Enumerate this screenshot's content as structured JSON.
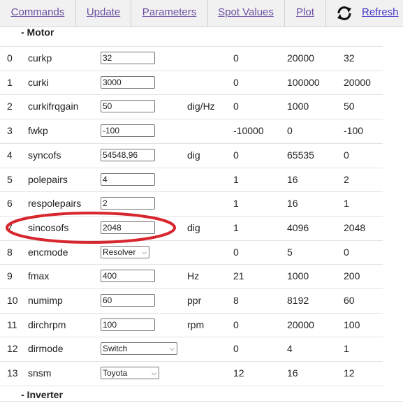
{
  "nav": {
    "commands": "Commands",
    "update": "Update",
    "parameters": "Parameters",
    "spot_values": "Spot Values",
    "plot": "Plot",
    "refresh": "Refresh",
    "refresh_icon": "refresh-icon"
  },
  "sections": {
    "motor": "- Motor",
    "inverter": "- Inverter"
  },
  "rows": [
    {
      "idx": "0",
      "name": "curkp",
      "value": "32",
      "unit": "",
      "min": "0",
      "max": "20000",
      "default": "32"
    },
    {
      "idx": "1",
      "name": "curki",
      "value": "3000",
      "unit": "",
      "min": "0",
      "max": "100000",
      "default": "20000"
    },
    {
      "idx": "2",
      "name": "curkifrqgain",
      "value": "50",
      "unit": "dig/Hz",
      "min": "0",
      "max": "1000",
      "default": "50"
    },
    {
      "idx": "3",
      "name": "fwkp",
      "value": "-100",
      "unit": "",
      "min": "-10000",
      "max": "0",
      "default": "-100"
    },
    {
      "idx": "4",
      "name": "syncofs",
      "value": "54548,96",
      "unit": "dig",
      "min": "0",
      "max": "65535",
      "default": "0"
    },
    {
      "idx": "5",
      "name": "polepairs",
      "value": "4",
      "unit": "",
      "min": "1",
      "max": "16",
      "default": "2"
    },
    {
      "idx": "6",
      "name": "respolepairs",
      "value": "2",
      "unit": "",
      "min": "1",
      "max": "16",
      "default": "1"
    },
    {
      "idx": "7",
      "name": "sincosofs",
      "value": "2048",
      "unit": "dig",
      "min": "1",
      "max": "4096",
      "default": "2048"
    },
    {
      "idx": "8",
      "name": "encmode",
      "value": "Resolver",
      "unit": "",
      "min": "0",
      "max": "5",
      "default": "0"
    },
    {
      "idx": "9",
      "name": "fmax",
      "value": "400",
      "unit": "Hz",
      "min": "21",
      "max": "1000",
      "default": "200"
    },
    {
      "idx": "10",
      "name": "numimp",
      "value": "60",
      "unit": "ppr",
      "min": "8",
      "max": "8192",
      "default": "60"
    },
    {
      "idx": "11",
      "name": "dirchrpm",
      "value": "100",
      "unit": "rpm",
      "min": "0",
      "max": "20000",
      "default": "100"
    },
    {
      "idx": "12",
      "name": "dirmode",
      "value": "Switch",
      "unit": "",
      "min": "0",
      "max": "4",
      "default": "1"
    },
    {
      "idx": "13",
      "name": "snsm",
      "value": "Toyota",
      "unit": "",
      "min": "12",
      "max": "16",
      "default": "12"
    }
  ],
  "annotation": {
    "color": "#d8262e",
    "target_row": "7"
  }
}
